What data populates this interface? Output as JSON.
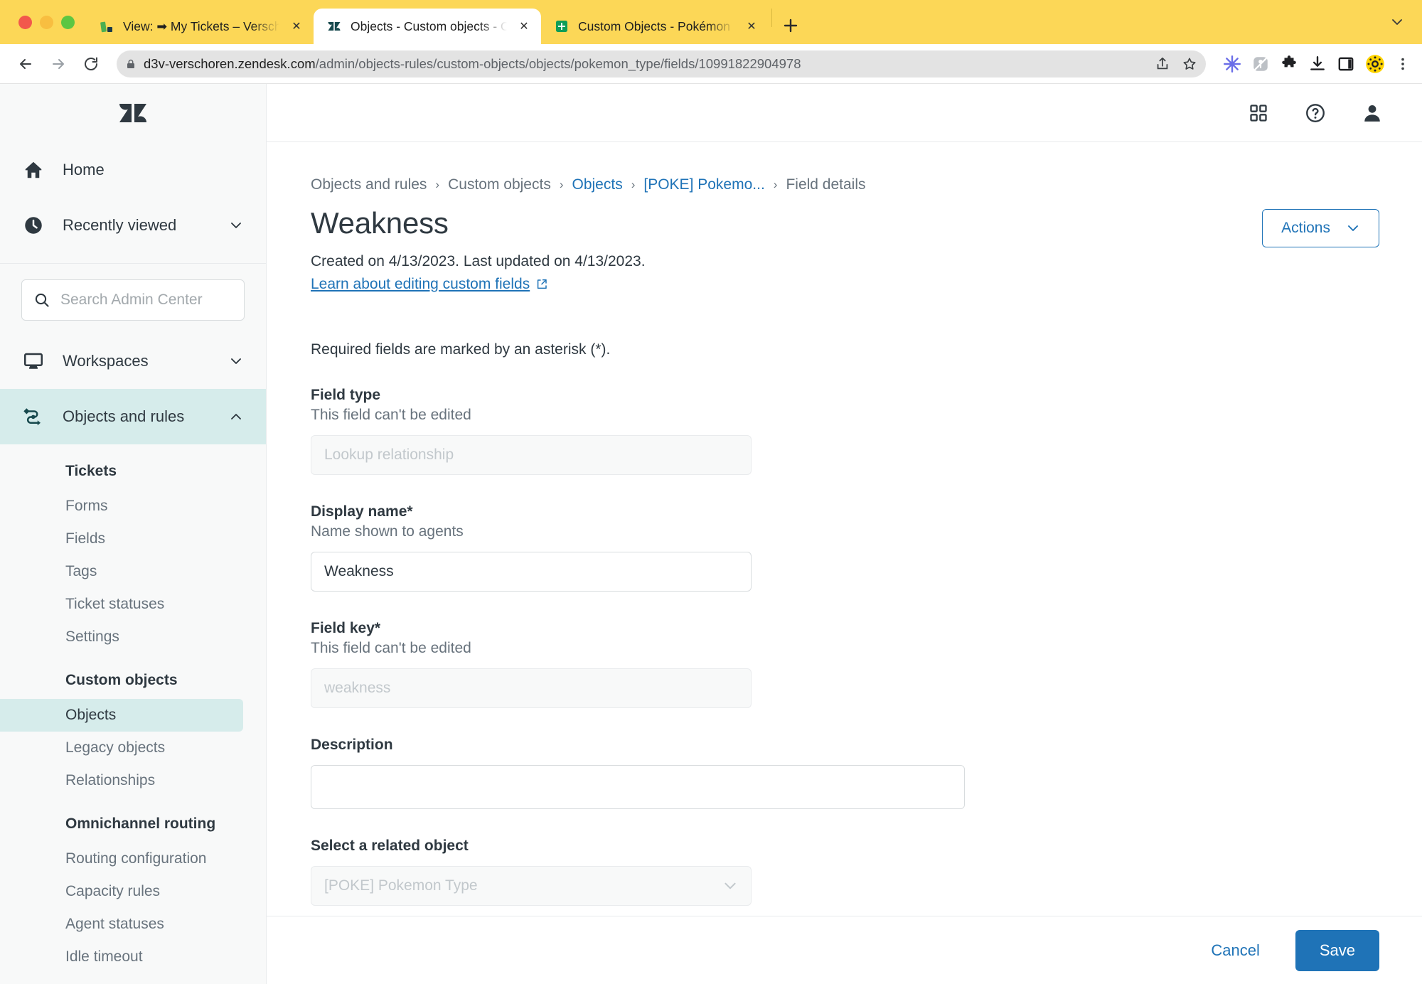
{
  "browser": {
    "tabs": [
      {
        "title": "View: ➡ My Tickets – Verschoren",
        "favicon": "chart-favicon",
        "active": false,
        "close_label": "✕"
      },
      {
        "title": "Objects - Custom objects - Ob",
        "favicon": "zendesk-favicon",
        "active": true,
        "close_label": "✕"
      },
      {
        "title": "Custom Objects - Pokémon - G",
        "favicon": "sheets-favicon",
        "active": false,
        "close_label": "✕"
      }
    ],
    "new_tab_label": "+",
    "tab_list_chevron": "chevron-down",
    "nav": {
      "back": "back-arrow",
      "forward": "forward-arrow",
      "reload": "reload-arrow"
    },
    "url": {
      "lock": "lock-icon",
      "domain": "d3v-verschoren.zendesk.com",
      "path": "/admin/objects-rules/custom-objects/objects/pokemon_type/fields/10991822904978"
    },
    "omnibox_icons": [
      "share-icon",
      "bookmark-star-icon"
    ],
    "extension_icons": [
      "snowflake-icon",
      "pen-slash-icon",
      "puzzle-icon",
      "download-icon",
      "sidepanel-icon",
      "profile-sun-icon",
      "kebab-menu-icon"
    ]
  },
  "sidebar": {
    "logo": "zendesk-logo",
    "top_items": [
      {
        "label": "Home",
        "icon": "home-icon",
        "chevron": false,
        "active": false
      },
      {
        "label": "Recently viewed",
        "icon": "clock-icon",
        "chevron": true,
        "active": false
      }
    ],
    "search": {
      "placeholder": "Search Admin Center",
      "icon": "search-icon",
      "value": ""
    },
    "nav_items": [
      {
        "label": "Workspaces",
        "icon": "monitor-icon",
        "chevron": "down",
        "active": false
      },
      {
        "label": "Objects and rules",
        "icon": "objects-rules-icon",
        "chevron": "up",
        "active": true
      }
    ],
    "groups": [
      {
        "title": "Tickets",
        "items": [
          {
            "label": "Forms",
            "active": false
          },
          {
            "label": "Fields",
            "active": false
          },
          {
            "label": "Tags",
            "active": false
          },
          {
            "label": "Ticket statuses",
            "active": false
          },
          {
            "label": "Settings",
            "active": false
          }
        ]
      },
      {
        "title": "Custom objects",
        "items": [
          {
            "label": "Objects",
            "active": true
          },
          {
            "label": "Legacy objects",
            "active": false
          },
          {
            "label": "Relationships",
            "active": false
          }
        ]
      },
      {
        "title": "Omnichannel routing",
        "items": [
          {
            "label": "Routing configuration",
            "active": false
          },
          {
            "label": "Capacity rules",
            "active": false
          },
          {
            "label": "Agent statuses",
            "active": false
          },
          {
            "label": "Idle timeout",
            "active": false
          }
        ]
      }
    ]
  },
  "header": {
    "icons": [
      "apps-grid-icon",
      "help-circle-icon",
      "user-avatar-icon"
    ]
  },
  "page": {
    "breadcrumb": [
      {
        "label": "Objects and rules",
        "link": false
      },
      {
        "label": "Custom objects",
        "link": false
      },
      {
        "label": "Objects",
        "link": true
      },
      {
        "label": "[POKE] Pokemo...",
        "link": true
      },
      {
        "label": "Field details",
        "link": false
      }
    ],
    "breadcrumb_separator": "›",
    "title": "Weakness",
    "meta": "Created on 4/13/2023. Last updated on 4/13/2023.",
    "learn_link": "Learn about editing custom fields",
    "learn_link_icon": "external-link-icon",
    "actions_button": {
      "label": "Actions",
      "chevron": "chevron-down-icon"
    },
    "required_note": "Required fields are marked by an asterisk (*).",
    "fields": [
      {
        "label": "Field type",
        "hint": "This field can't be edited",
        "value": "",
        "placeholder": "Lookup relationship",
        "disabled": true,
        "kind": "text"
      },
      {
        "label": "Display name*",
        "hint": "Name shown to agents",
        "value": "Weakness",
        "placeholder": "",
        "disabled": false,
        "kind": "text"
      },
      {
        "label": "Field key*",
        "hint": "This field can't be edited",
        "value": "",
        "placeholder": "weakness",
        "disabled": true,
        "kind": "text"
      },
      {
        "label": "Description",
        "hint": "",
        "value": "",
        "placeholder": "",
        "disabled": false,
        "kind": "textarea"
      },
      {
        "label": "Select a related object",
        "hint": "",
        "value": "",
        "placeholder": "[POKE] Pokemon Type",
        "disabled": true,
        "kind": "select"
      }
    ],
    "footer": {
      "cancel": "Cancel",
      "save": "Save"
    }
  },
  "colors": {
    "accent_blue": "#1f73b7",
    "zendesk_teal": "#d6eceb",
    "tabstrip_yellow": "#FCD757",
    "text_dark": "#2f3941",
    "text_muted": "#68737d"
  }
}
